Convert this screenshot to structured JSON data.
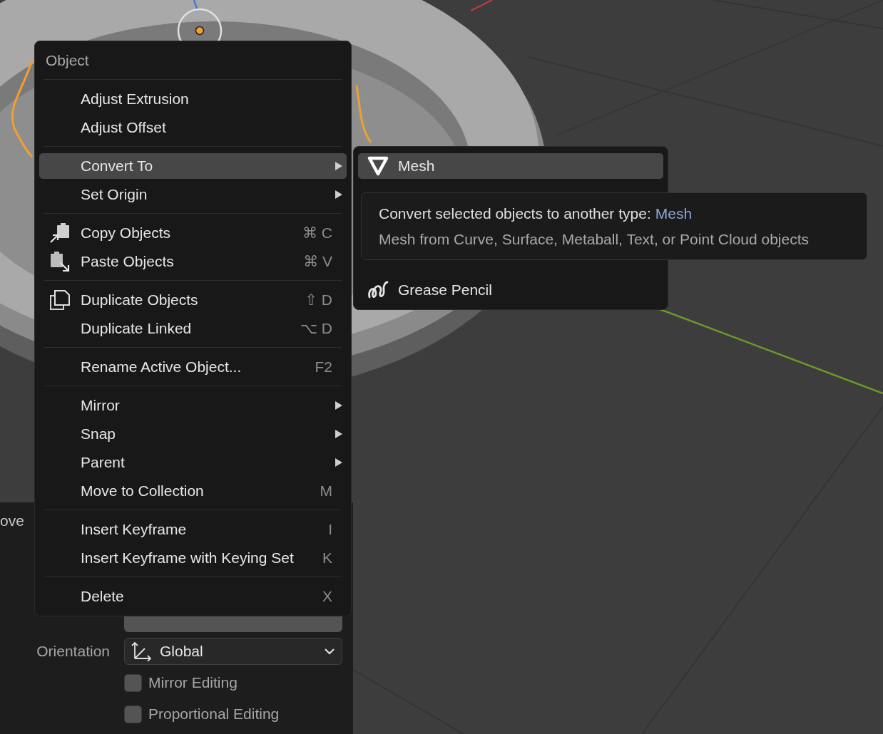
{
  "operator_panel": {
    "title": "ove",
    "orientation": {
      "label": "Orientation",
      "value": "Global"
    },
    "options": [
      {
        "label": "Mirror Editing",
        "checked": false
      },
      {
        "label": "Proportional Editing",
        "checked": false
      }
    ]
  },
  "context_menu": {
    "title": "Object",
    "groups": [
      {
        "items": [
          {
            "label": "Adjust Extrusion",
            "kind": "plain",
            "selected": false
          },
          {
            "label": "Adjust Offset",
            "kind": "plain",
            "selected": false
          }
        ]
      },
      {
        "items": [
          {
            "label": "Convert To",
            "kind": "plain",
            "submenu": true,
            "selected": true
          },
          {
            "label": "Set Origin",
            "kind": "plain",
            "submenu": true,
            "selected": false
          }
        ]
      },
      {
        "items": [
          {
            "label": "Copy Objects",
            "kind": "copy",
            "shortcut": "⌘ C",
            "selected": false
          },
          {
            "label": "Paste Objects",
            "kind": "paste",
            "shortcut": "⌘ V",
            "selected": false
          }
        ]
      },
      {
        "items": [
          {
            "label": "Duplicate Objects",
            "kind": "duplicate",
            "shortcut": "⇧ D",
            "selected": false
          },
          {
            "label": "Duplicate Linked",
            "kind": "plain",
            "shortcut": "⌥ D",
            "selected": false
          }
        ]
      },
      {
        "items": [
          {
            "label": "Rename Active Object...",
            "kind": "plain",
            "shortcut": "F2",
            "selected": false
          }
        ]
      },
      {
        "items": [
          {
            "label": "Mirror",
            "kind": "plain",
            "submenu": true,
            "selected": false
          },
          {
            "label": "Snap",
            "kind": "plain",
            "submenu": true,
            "selected": false
          },
          {
            "label": "Parent",
            "kind": "plain",
            "submenu": true,
            "selected": false
          },
          {
            "label": "Move to Collection",
            "kind": "plain",
            "shortcut": "M",
            "selected": false
          }
        ]
      },
      {
        "items": [
          {
            "label": "Insert Keyframe",
            "kind": "plain",
            "shortcut": "I",
            "selected": false
          },
          {
            "label": "Insert Keyframe with Keying Set",
            "kind": "plain",
            "shortcut": "K",
            "selected": false
          }
        ]
      },
      {
        "items": [
          {
            "label": "Delete",
            "kind": "plain",
            "shortcut": "X",
            "selected": false
          }
        ]
      }
    ]
  },
  "submenu": {
    "items": [
      {
        "label": "Mesh",
        "kind": "mesh",
        "selected": true
      },
      {
        "label": "Grease Pencil",
        "kind": "grease-pencil",
        "selected": false
      }
    ]
  },
  "tooltip": {
    "text": "Convert selected objects to another type:",
    "value": "Mesh",
    "detail": "Mesh from Curve, Surface, Metaball, Text, or Point Cloud objects"
  }
}
